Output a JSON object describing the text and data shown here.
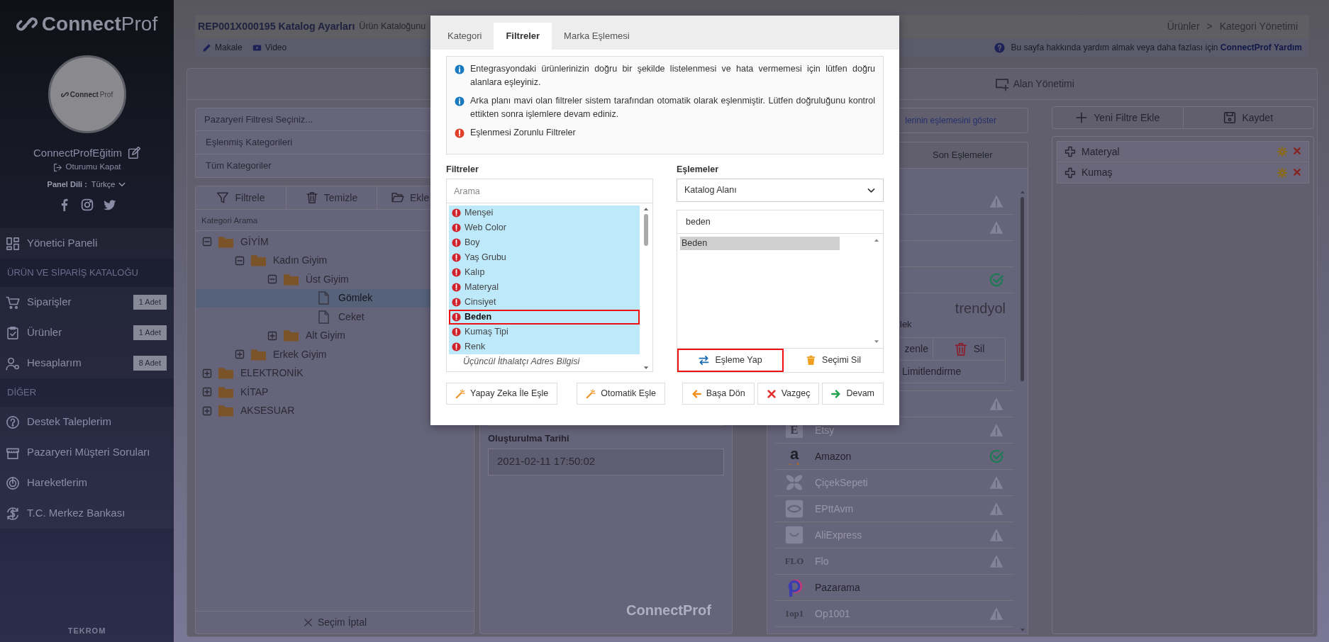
{
  "sidebar": {
    "brand": {
      "first": "Connect",
      "second": "Prof"
    },
    "avatar_brand": {
      "first": "Connect",
      "second": "Prof"
    },
    "user": "ConnectProfEğitim",
    "logout": "Oturumu Kapat",
    "language_label": "Panel Dili :",
    "language": "Türkçe",
    "menu": [
      {
        "kind": "item",
        "label": "Yönetici Paneli"
      },
      {
        "kind": "section",
        "label": "ÜRÜN VE SİPARİŞ KATALOĞU"
      },
      {
        "kind": "item",
        "label": "Siparişler",
        "badge": "1 Adet"
      },
      {
        "kind": "item",
        "label": "Ürünler",
        "badge": "1 Adet"
      },
      {
        "kind": "item",
        "label": "Hesaplarım",
        "badge": "8 Adet"
      },
      {
        "kind": "section",
        "label": "DİĞER"
      },
      {
        "kind": "item",
        "label": "Destek Taleplerim"
      },
      {
        "kind": "item",
        "label": "Pazaryeri Müşteri Soruları"
      },
      {
        "kind": "item",
        "label": "Hareketlerim"
      },
      {
        "kind": "item",
        "label": "T.C. Merkez Bankası"
      }
    ],
    "footer": "TEKROM"
  },
  "header": {
    "title": "REP001X000195 Katalog Ayarları",
    "subtitle": "Ürün Kataloğunu",
    "breadcrumb": [
      "Ürünler",
      "Kategori Yönetimi"
    ],
    "breadcrumb_separator": ">"
  },
  "help_bar": {
    "links": [
      "Makale",
      "Video"
    ],
    "text": "Bu sayfa hakkında yardım almak veya daha fazlası için",
    "link": "ConnectProf Yardım"
  },
  "page_tabs": [
    {
      "label": "Alan Yönetimi"
    }
  ],
  "category_panel": {
    "marketplace_filter": {
      "placeholder": "Pazaryeri Filtresi Seçiniz..."
    },
    "views": [
      "Eşlenmiş Kategorileri",
      "Tüm Kategoriler"
    ],
    "toolbar": [
      "Filtrele",
      "Temizle",
      "Ekle"
    ],
    "search": {
      "placeholder": "Kategori Arama"
    },
    "tree": [
      {
        "label": "GİYİM",
        "kind": "folder",
        "expanded": true,
        "selected": false,
        "children": [
          {
            "label": "Kadın Giyim",
            "kind": "folder",
            "expanded": true,
            "selected": false,
            "children": [
              {
                "label": "Üst Giyim",
                "kind": "folder",
                "expanded": true,
                "selected": false,
                "children": [
                  {
                    "label": "Gömlek",
                    "kind": "file",
                    "selected": true
                  },
                  {
                    "label": "Ceket",
                    "kind": "file",
                    "selected": false
                  }
                ]
              },
              {
                "label": "Alt Giyim",
                "kind": "folder",
                "expanded": false,
                "selected": false
              }
            ]
          },
          {
            "label": "Erkek Giyim",
            "kind": "folder",
            "expanded": false,
            "selected": false
          }
        ]
      },
      {
        "label": "ELEKTRONİK",
        "kind": "folder",
        "expanded": false,
        "selected": false
      },
      {
        "label": "KİTAP",
        "kind": "folder",
        "expanded": false,
        "selected": false
      },
      {
        "label": "AKSESUAR",
        "kind": "folder",
        "expanded": false,
        "selected": false
      }
    ],
    "cancel": "Seçim İptal"
  },
  "details": {
    "created_label": "Oluşturulma Tarihi",
    "created_value": "2021-02-11 17:50:02",
    "watermark": "ConnectProf"
  },
  "marketplace_panel": {
    "show_link": "lerinin eşlemesini göster",
    "tab": "Son Eşlemeler",
    "rows": [
      {
        "kind": "row",
        "warning": true,
        "matched": false
      },
      {
        "kind": "row",
        "warning": true,
        "matched": false
      },
      {
        "kind": "row",
        "warning": false,
        "matched": false
      },
      {
        "kind": "row",
        "warning": false,
        "matched": true
      },
      {
        "kind": "detail",
        "logo": "trendyol",
        "category": "lek",
        "actions": [
          "zenle",
          "Sil"
        ],
        "limit": "Limitlendirme"
      },
      {
        "kind": "row",
        "warning": true,
        "matched": false
      },
      {
        "kind": "row",
        "logo_text": "E",
        "name": "Etsy",
        "active": false,
        "warning": true,
        "matched": false
      },
      {
        "kind": "row",
        "logo_text": "a",
        "name": "Amazon",
        "active": true,
        "warning": false,
        "matched": true
      },
      {
        "kind": "row",
        "name": "ÇiçekSepeti",
        "active": false,
        "warning": true,
        "matched": false
      },
      {
        "kind": "row",
        "name": "EPttAvm",
        "active": false,
        "warning": true,
        "matched": false
      },
      {
        "kind": "row",
        "name": "AliExpress",
        "active": false,
        "warning": true,
        "matched": false
      },
      {
        "kind": "row",
        "logo_text": "FLO",
        "name": "Flo",
        "active": false,
        "warning": true,
        "matched": false
      },
      {
        "kind": "row",
        "name": "Pazarama",
        "active": true,
        "warning": false,
        "matched": false
      },
      {
        "kind": "row",
        "logo_text": "1op1",
        "name": "Op1001",
        "active": false,
        "warning": true,
        "matched": false
      }
    ]
  },
  "filter_manager": {
    "buttons": [
      "Yeni Filtre Ekle",
      "Kaydet"
    ],
    "filters": [
      {
        "label": "Materyal"
      },
      {
        "label": "Kumaş"
      }
    ]
  },
  "modal": {
    "tabs": [
      {
        "label": "Kategori",
        "selected": false
      },
      {
        "label": "Filtreler",
        "selected": true
      },
      {
        "label": "Marka Eşlemesi",
        "selected": false
      }
    ],
    "info": [
      {
        "kind": "info",
        "text": "Entegrasyondaki ürünlerinizin doğru bir şekilde listelenmesi ve hata vermemesi için lütfen doğru alanlara eşleyiniz."
      },
      {
        "kind": "info",
        "text": "Arka planı mavi olan filtreler sistem tarafından otomatik olarak eşlenmiştir. Lütfen doğruluğunu kontrol ettikten sonra işlemlere devam ediniz."
      },
      {
        "kind": "required",
        "text": "Eşlenmesi Zorunlu Filtreler"
      }
    ],
    "filters": {
      "title": "Filtreler",
      "search": {
        "placeholder": "Arama"
      },
      "items": [
        {
          "label": "Menşei",
          "required": true,
          "auto_matched": true,
          "selected": false,
          "highlighted": false
        },
        {
          "label": "Web Color",
          "required": true,
          "auto_matched": true,
          "selected": false,
          "highlighted": false
        },
        {
          "label": "Boy",
          "required": true,
          "auto_matched": true,
          "selected": false,
          "highlighted": false
        },
        {
          "label": "Yaş Grubu",
          "required": true,
          "auto_matched": true,
          "selected": false,
          "highlighted": false
        },
        {
          "label": "Kalıp",
          "required": true,
          "auto_matched": true,
          "selected": false,
          "highlighted": false
        },
        {
          "label": "Materyal",
          "required": true,
          "auto_matched": true,
          "selected": false,
          "highlighted": false
        },
        {
          "label": "Cinsiyet",
          "required": true,
          "auto_matched": true,
          "selected": false,
          "highlighted": false
        },
        {
          "label": "Beden",
          "required": true,
          "auto_matched": true,
          "selected": true,
          "highlighted": true
        },
        {
          "label": "Kumaş Tipi",
          "required": true,
          "auto_matched": true,
          "selected": false,
          "highlighted": false
        },
        {
          "label": "Renk",
          "required": true,
          "auto_matched": true,
          "selected": false,
          "highlighted": false
        },
        {
          "label": "Üçüncül İthalatçı Adres Bilgisi",
          "required": false,
          "auto_matched": false,
          "selected": false,
          "highlighted": false
        }
      ]
    },
    "mappings": {
      "title": "Eşlemeler",
      "source": "Katalog Alanı",
      "search": {
        "value": "beden"
      },
      "items": [
        {
          "label": "Beden",
          "selected": true
        }
      ],
      "actions": [
        {
          "label": "Eşleme Yap",
          "highlighted": true
        },
        {
          "label": "Seçimi Sil",
          "highlighted": false
        }
      ]
    },
    "buttons_left": [
      "Yapay Zeka İle Eşle",
      "Otomatik Eşle"
    ],
    "buttons_right": [
      "Başa Dön",
      "Vazgeç",
      "Devam"
    ]
  }
}
